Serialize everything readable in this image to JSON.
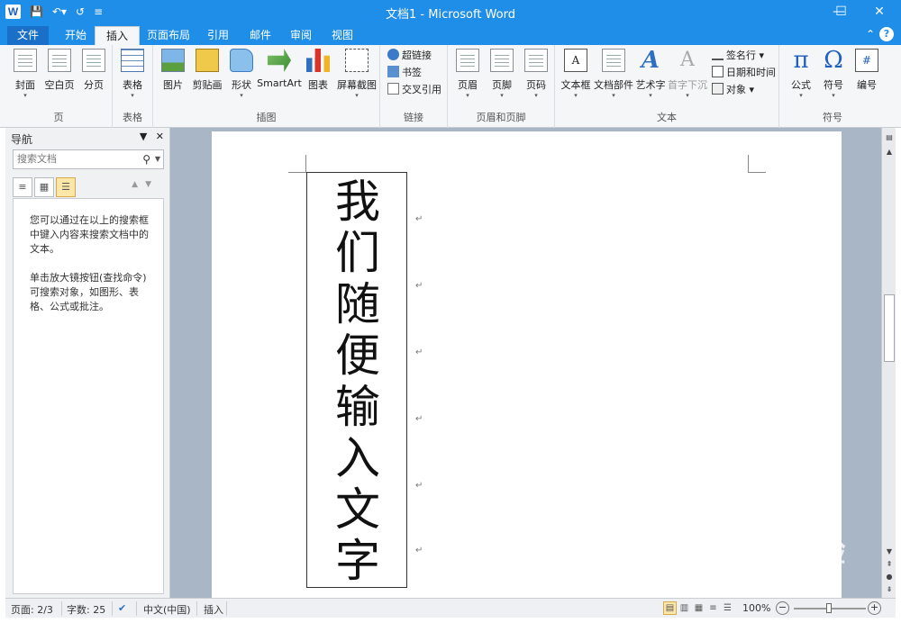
{
  "window": {
    "title": "文档1 - Microsoft Word",
    "app_icon": "W",
    "minimize": "—",
    "maximize": "☐",
    "close": "✕"
  },
  "qat": [
    "save-icon",
    "undo-icon",
    "redo-icon",
    "customize-icon"
  ],
  "tabs": [
    {
      "label": "文件"
    },
    {
      "label": "开始"
    },
    {
      "label": "插入"
    },
    {
      "label": "页面布局"
    },
    {
      "label": "引用"
    },
    {
      "label": "邮件"
    },
    {
      "label": "审阅"
    },
    {
      "label": "视图"
    }
  ],
  "active_tab": "插入",
  "ribbon": {
    "groups": {
      "pages": {
        "label": "页",
        "buttons": [
          "封面",
          "空白页",
          "分页"
        ]
      },
      "tables": {
        "label": "表格",
        "buttons": [
          "表格"
        ]
      },
      "illustrations": {
        "label": "插图",
        "buttons": [
          "图片",
          "剪贴画",
          "形状",
          "SmartArt",
          "图表",
          "屏幕截图"
        ]
      },
      "links": {
        "label": "链接",
        "buttons": [
          "超链接",
          "书签",
          "交叉引用"
        ]
      },
      "header_footer": {
        "label": "页眉和页脚",
        "buttons": [
          "页眉",
          "页脚",
          "页码"
        ]
      },
      "text": {
        "label": "文本",
        "buttons": [
          "文本框",
          "文档部件",
          "艺术字",
          "首字下沉"
        ],
        "small": [
          "签名行",
          "日期和时间",
          "对象"
        ]
      },
      "symbols": {
        "label": "符号",
        "buttons": [
          "公式",
          "符号",
          "编号"
        ]
      }
    }
  },
  "nav": {
    "title": "导航",
    "search_placeholder": "搜索文档",
    "help_1": "您可以通过在以上的搜索框中键入内容来搜索文档中的文本。",
    "help_2": "单击放大镜按钮(查找命令)可搜索对象，如图形、表格、公式或批注。"
  },
  "document": {
    "vertical_text": [
      "我",
      "们",
      "随",
      "便",
      "输",
      "入",
      "文",
      "字"
    ],
    "paragraph_mark": "↵"
  },
  "status": {
    "page": "页面: 2/3",
    "words": "字数: 25",
    "language": "中文(中国)",
    "mode": "插入",
    "zoom": "100%"
  },
  "watermark": {
    "line1": "Baidu经验",
    "line2": "jingyan.baidu.com"
  }
}
